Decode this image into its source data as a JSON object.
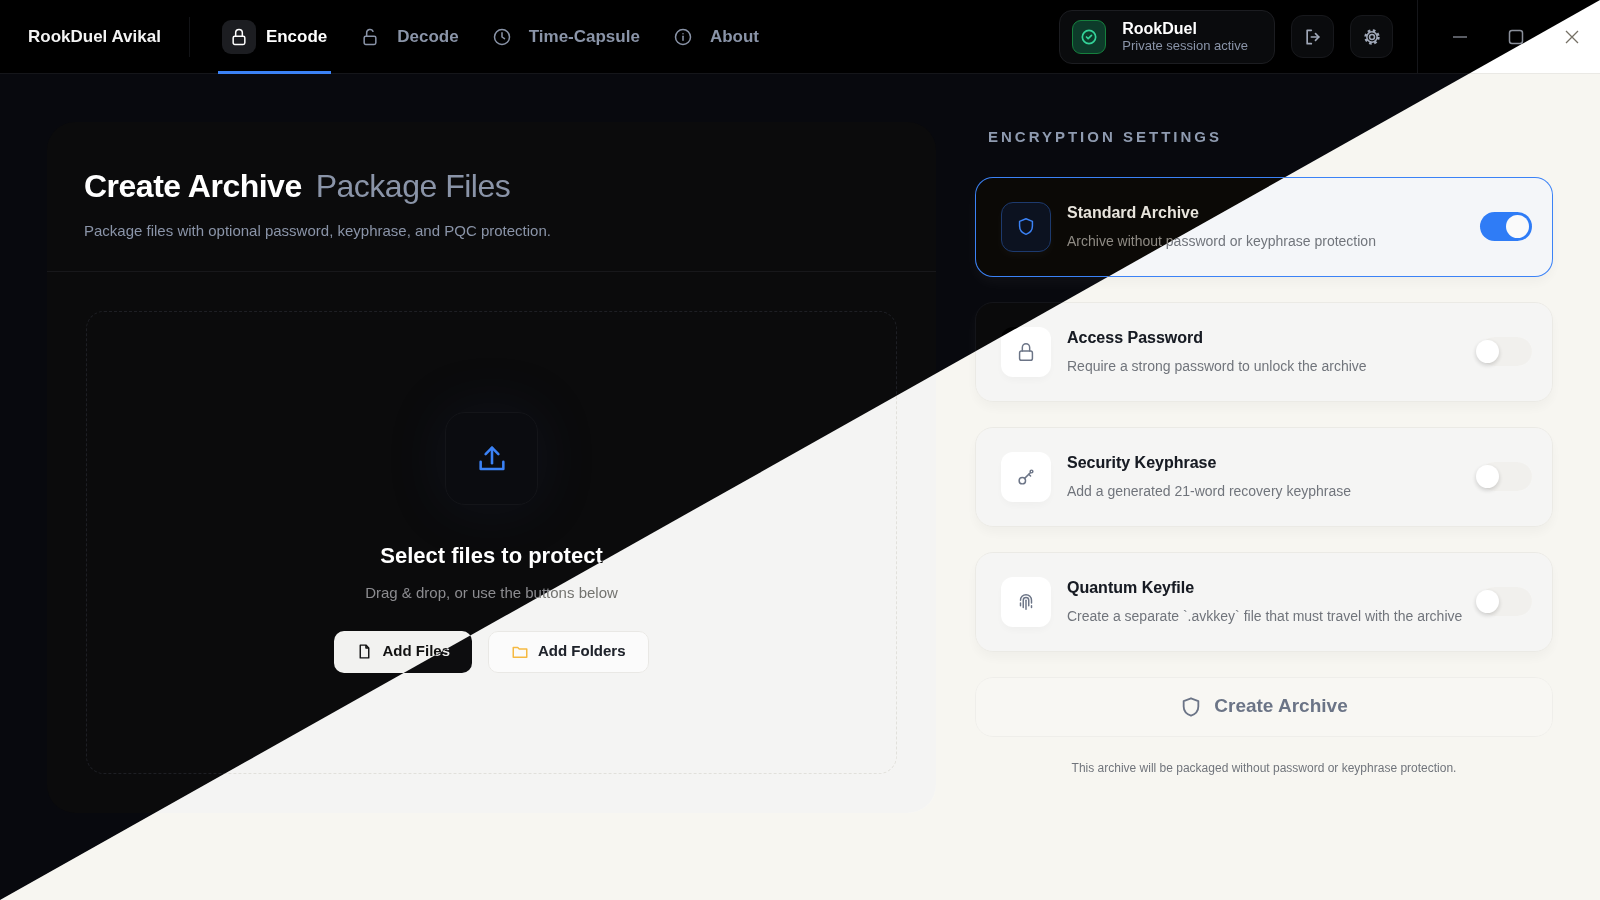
{
  "app": {
    "brand": "RookDuel Avikal"
  },
  "tabs": [
    {
      "label": "Encode",
      "selected": true
    },
    {
      "label": "Decode",
      "selected": false
    },
    {
      "label": "Time-Capsule",
      "selected": false
    },
    {
      "label": "About",
      "selected": false
    }
  ],
  "session": {
    "name": "RookDuel",
    "status": "Private session active"
  },
  "archive_panel": {
    "title": "Create Archive",
    "subtitle": "Package Files",
    "description": "Package files with optional password, keyphrase, and PQC protection.",
    "dropzone": {
      "heading": "Select files to protect",
      "hint": "Drag & drop, or use the buttons below",
      "buttons": [
        "Add Files",
        "Add Folders"
      ]
    }
  },
  "settings_heading": "ENCRYPTION SETTINGS",
  "settings": [
    {
      "title": "Standard Archive",
      "description": "Archive without password or keyphrase protection",
      "on": true
    },
    {
      "title": "Access Password",
      "description": "Require a strong password to unlock the archive",
      "on": false
    },
    {
      "title": "Security Keyphrase",
      "description": "Add a generated 21-word recovery keyphrase",
      "on": false
    },
    {
      "title": "Quantum Keyfile",
      "description": "Create a separate `.avkkey` file that must travel with the archive",
      "on": false
    }
  ],
  "create_button": "Create Archive",
  "footnote": "This archive will be packaged without password or keyphrase protection."
}
